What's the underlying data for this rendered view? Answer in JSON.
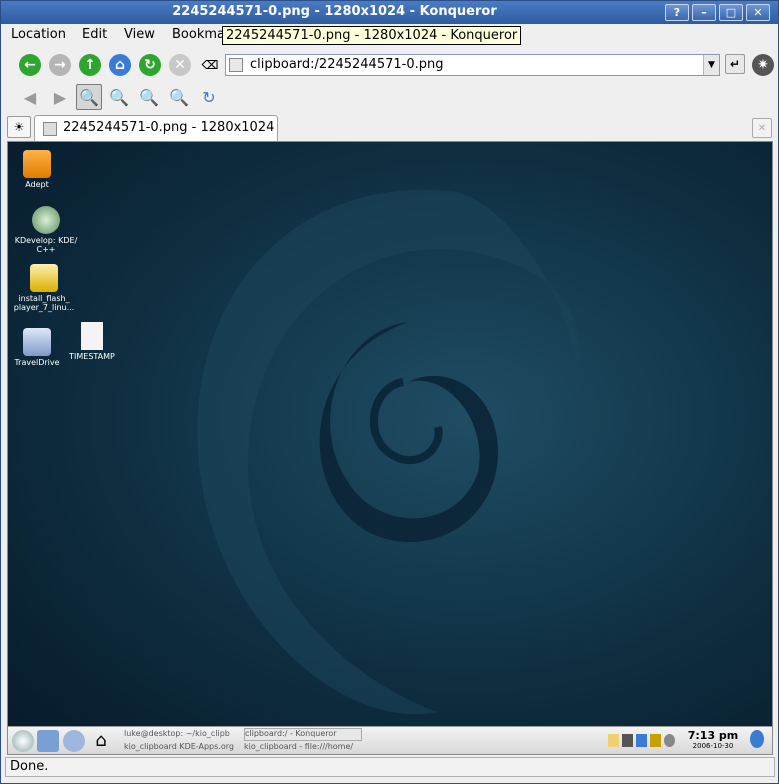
{
  "window": {
    "title": "2245244571-0.png - 1280x1024 - Konqueror",
    "buttons": {
      "help": "?",
      "minimize": "–",
      "maximize": "□",
      "close": "✕"
    }
  },
  "menu": {
    "items": [
      "Location",
      "Edit",
      "View",
      "Bookma"
    ]
  },
  "tooltip": {
    "text": "2245244571-0.png - 1280x1024 - Konqueror"
  },
  "location": {
    "url": "clipboard:/2245244571-0.png"
  },
  "tab": {
    "label": "2245244571-0.png - 1280x1024"
  },
  "desktop": {
    "icons": [
      {
        "label": "Adept"
      },
      {
        "label": "KDevelop: KDE/ C++"
      },
      {
        "label": "install_flash_ player_7_linu..."
      },
      {
        "label": "TravelDrive"
      },
      {
        "label": "TIMESTAMP"
      }
    ],
    "taskbar": {
      "tasks": [
        "luke@desktop: ~/kio_clipb",
        "clipboard:/ - Konqueror",
        "kio_clipboard KDE-Apps.org",
        "kio_clipboard - file:///home/"
      ]
    },
    "clock": {
      "time": "7:13 pm",
      "date": "2006-10-30"
    }
  },
  "status": {
    "text": "Done."
  },
  "colors": {
    "titlebar": "#2e5c9f",
    "desktop_bg": "#0e2e40",
    "tooltip_bg": "#ffffdc"
  }
}
